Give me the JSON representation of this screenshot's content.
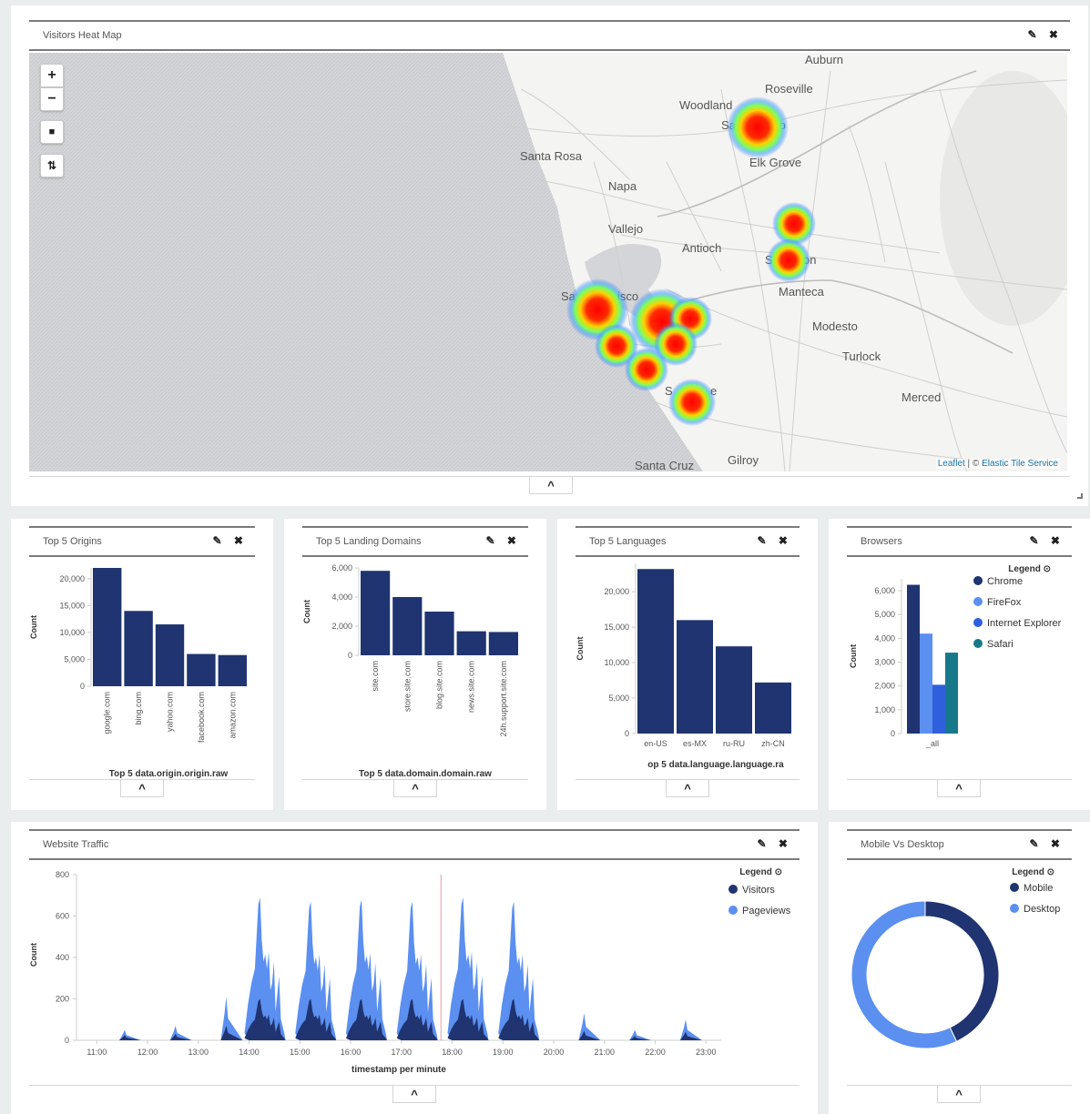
{
  "heatmap": {
    "title": "Visitors Heat Map",
    "actions": "✎ ✖",
    "zoom_in": "+",
    "zoom_out": "−",
    "draw_rect": "■",
    "fit": "⇅",
    "attribution_leaflet": "Leaflet",
    "attribution_sep": " | © ",
    "attribution_tiles": "Elastic Tile Service",
    "collapse": "^",
    "places": [
      "Auburn",
      "Roseville",
      "Woodland",
      "Sa",
      "to",
      "Santa Rosa",
      "Elk Grove",
      "Napa",
      "Vallejo",
      "Antioch",
      "S",
      "on",
      "Manteca",
      "Sa",
      "isco",
      "Modesto",
      "Turlock",
      "Merced",
      "S",
      "e",
      "Santa Cruz",
      "Gilroy"
    ],
    "icons": {
      "zoom_in": "plus-icon",
      "zoom_out": "minus-icon",
      "draw": "square-icon",
      "fit": "fit-bounds-icon"
    }
  },
  "origins": {
    "title": "Top 5 Origins",
    "actions": "✎ ✖",
    "collapse": "^",
    "chart_data": {
      "type": "bar",
      "categories": [
        "google.com",
        "bing.com",
        "yahoo.com",
        "facebook.com",
        "amazon.com"
      ],
      "values": [
        22000,
        14000,
        11500,
        6000,
        5800
      ],
      "ylim": [
        0,
        22000
      ],
      "yticks": [
        "20,000",
        "15,000",
        "10,000",
        "5,000",
        "0"
      ],
      "ylabel": "Count",
      "xlabel": "Top 5 data.origin.origin.raw",
      "color": "#1f3470"
    }
  },
  "domains": {
    "title": "Top 5 Landing Domains",
    "actions": "✎ ✖",
    "collapse": "^",
    "chart_data": {
      "type": "bar",
      "categories": [
        "site.com",
        "store.site.com",
        "blog.site.com",
        "news.site.com",
        "24h.support.site.com"
      ],
      "values": [
        5800,
        4000,
        3000,
        1650,
        1600
      ],
      "ylim": [
        0,
        6000
      ],
      "yticks": [
        "6,000",
        "4,000",
        "2,000",
        "0"
      ],
      "ylabel": "Count",
      "xlabel": "Top 5 data.domain.domain.raw",
      "color": "#1f3470"
    }
  },
  "languages": {
    "title": "Top 5 Languages",
    "actions": "✎ ✖",
    "collapse": "^",
    "chart_data": {
      "type": "bar",
      "categories": [
        "en-US",
        "es-MX",
        "ru-RU",
        "zh-CN"
      ],
      "values": [
        23200,
        16000,
        12300,
        7200
      ],
      "ylim": [
        0,
        24000
      ],
      "yticks": [
        "20,000",
        "15,000",
        "10,000",
        "5,000",
        "0"
      ],
      "ylabel": "Count",
      "xlabel": "op 5 data.language.language.ra",
      "color": "#1f3470"
    }
  },
  "browsers": {
    "title": "Browsers",
    "actions": "✎ ✖",
    "collapse": "^",
    "legend_title": "Legend ⊙",
    "chart_data": {
      "type": "bar",
      "categories": [
        "_all"
      ],
      "series": [
        {
          "name": "Chrome",
          "values": [
            6250
          ],
          "color": "#1f3470"
        },
        {
          "name": "FireFox",
          "values": [
            4200
          ],
          "color": "#5b8ff0"
        },
        {
          "name": "Internet Explorer",
          "values": [
            2050
          ],
          "color": "#2f5fdc"
        },
        {
          "name": "Safari",
          "values": [
            3400
          ],
          "color": "#17788a"
        }
      ],
      "ylim": [
        0,
        6500
      ],
      "yticks": [
        "6,000",
        "5,000",
        "4,000",
        "3,000",
        "2,000",
        "1,000",
        "0"
      ],
      "ylabel": "Count",
      "xlabel": ""
    }
  },
  "traffic": {
    "title": "Website Traffic",
    "actions": "✎ ✖",
    "collapse": "^",
    "legend_title": "Legend ⊙",
    "chart_data": {
      "type": "area",
      "x_ticks": [
        "11:00",
        "12:00",
        "13:00",
        "14:00",
        "15:00",
        "16:00",
        "17:00",
        "18:00",
        "19:00",
        "20:00",
        "21:00",
        "22:00",
        "23:00"
      ],
      "yticks": [
        "800",
        "600",
        "400",
        "200",
        "0"
      ],
      "ylim": [
        0,
        800
      ],
      "ylabel": "Count",
      "xlabel": "timestamp per minute",
      "series": [
        {
          "name": "Visitors",
          "color": "#1f3470"
        },
        {
          "name": "Pageviews",
          "color": "#5b8ff0"
        }
      ],
      "bursts": [
        {
          "t": 11.55,
          "peak": 50,
          "visitors": 25
        },
        {
          "t": 12.55,
          "peak": 70,
          "visitors": 30
        },
        {
          "t": 13.55,
          "peak": 210,
          "visitors": 70
        },
        {
          "t": 14.25,
          "peak": 690,
          "visitors": 200
        },
        {
          "t": 15.25,
          "peak": 670,
          "visitors": 200
        },
        {
          "t": 16.25,
          "peak": 680,
          "visitors": 200
        },
        {
          "t": 17.25,
          "peak": 670,
          "visitors": 200
        },
        {
          "t": 18.25,
          "peak": 690,
          "visitors": 200
        },
        {
          "t": 19.25,
          "peak": 670,
          "visitors": 200
        },
        {
          "t": 20.6,
          "peak": 130,
          "visitors": 45
        },
        {
          "t": 21.6,
          "peak": 50,
          "visitors": 20
        },
        {
          "t": 22.6,
          "peak": 100,
          "visitors": 40
        }
      ],
      "current_time": 17.78,
      "xlim": [
        10.6,
        23.3
      ]
    }
  },
  "device": {
    "title": "Mobile Vs Desktop",
    "actions": "✎ ✖",
    "collapse": "^",
    "legend_title": "Legend ⊙",
    "chart_data": {
      "type": "pie",
      "donut": true,
      "series": [
        {
          "name": "Mobile",
          "value": 43,
          "color": "#1f3470"
        },
        {
          "name": "Desktop",
          "value": 57,
          "color": "#5b8ff0"
        }
      ]
    }
  }
}
